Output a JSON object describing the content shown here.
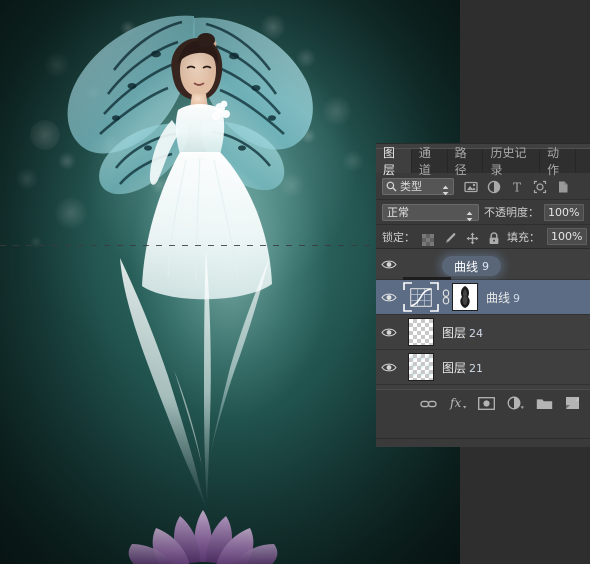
{
  "app": {
    "name": "Adobe Photoshop",
    "locale": "zh-CN"
  },
  "canvas": {
    "artwork_description": "butterfly-fairy-bride-composite",
    "selection_active": true,
    "background_colors": [
      "#0a1f1d",
      "#1d4a46",
      "#2d6d66"
    ],
    "lotus_color": "#a06bbf",
    "wing_color": "#8fd3d8"
  },
  "panel": {
    "tabs": [
      {
        "label": "图层",
        "active": true
      },
      {
        "label": "通道",
        "active": false
      },
      {
        "label": "路径",
        "active": false
      },
      {
        "label": "历史记录",
        "active": false
      },
      {
        "label": "动作",
        "active": false
      }
    ],
    "filter": {
      "search_icon": "search-icon",
      "value": "类型",
      "icons": [
        "pixel-layer-filter-icon",
        "adjustment-layer-filter-icon",
        "type-layer-filter-icon",
        "shape-layer-filter-icon",
        "smart-object-filter-icon"
      ]
    },
    "blend": {
      "mode_value": "正常",
      "opacity_label": "不透明度：",
      "opacity_value": "100%"
    },
    "lock": {
      "label": "锁定：",
      "icons": [
        "lock-transparent-pixels-icon",
        "lock-image-pixels-icon",
        "lock-position-icon",
        "lock-all-icon"
      ],
      "fill_label": "填充：",
      "fill_value": "100%"
    },
    "drag_ghost": {
      "name": "曲线",
      "number": "9"
    },
    "layers": [
      {
        "name": "",
        "number": "",
        "visible": true,
        "selected": false,
        "kind": "empty-row",
        "thumb": "none"
      },
      {
        "name": "曲线",
        "number": "9",
        "visible": true,
        "selected": true,
        "kind": "curves-adjustment",
        "thumb": "curves-icon",
        "mask": "layer-mask-thumbnail",
        "linked": true
      },
      {
        "name": "图层",
        "number": "24",
        "visible": true,
        "selected": false,
        "kind": "pixel",
        "thumb": "transparent-checker"
      },
      {
        "name": "图层",
        "number": "21",
        "visible": true,
        "selected": false,
        "kind": "pixel",
        "thumb": "transparent-checker"
      }
    ],
    "bottom_buttons": [
      {
        "icon": "link-layers-icon"
      },
      {
        "icon": "layer-style-fx-icon"
      },
      {
        "icon": "add-layer-mask-icon"
      },
      {
        "icon": "new-fill-adjustment-layer-icon"
      },
      {
        "icon": "new-group-icon"
      },
      {
        "icon": "new-layer-icon"
      }
    ],
    "colors": {
      "panel_bg": "#3a3a3a",
      "list_bg": "#3f3f3f",
      "selected_row": "#5b6c84",
      "tab_active_bg": "#3f3f3f",
      "text": "#e9e9e9"
    }
  }
}
